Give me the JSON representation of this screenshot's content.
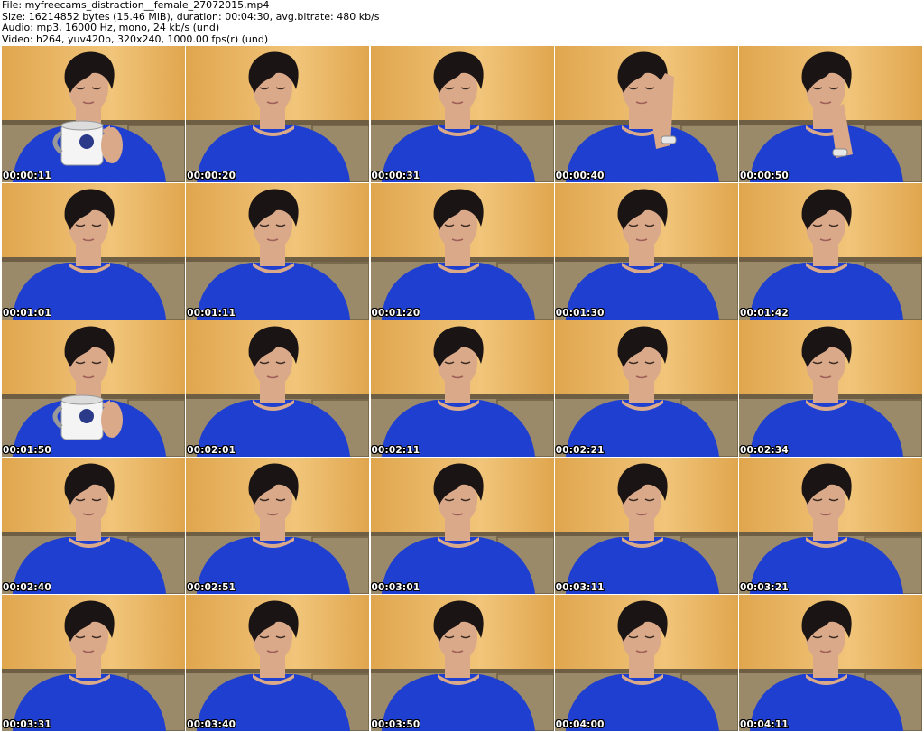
{
  "header": {
    "file_line": "File: myfreecams_distraction__female_27072015.mp4",
    "size_line": "Size: 16214852 bytes (15.46 MiB), duration: 00:04:30, avg.bitrate: 480 kb/s",
    "audio_line": "Audio: mp3, 16000 Hz, mono, 24 kb/s (und)",
    "video_line": "Video: h264, yuv420p, 320x240, 1000.00 fps(r) (und)"
  },
  "colors": {
    "wall": "#e0a64e",
    "wall_light": "#f1c57a",
    "sofa": "#9a8a6a",
    "sofa_dark": "#6e5f44",
    "sweater": "#1f3fd0",
    "skin": "#d9a98a",
    "hair": "#1a1414",
    "mug": "#f4f4f4"
  },
  "thumbnails": [
    {
      "time": "00:00:11",
      "pose": "mug"
    },
    {
      "time": "00:00:20",
      "pose": "down"
    },
    {
      "time": "00:00:31",
      "pose": "down"
    },
    {
      "time": "00:00:40",
      "pose": "hand"
    },
    {
      "time": "00:00:50",
      "pose": "chin"
    },
    {
      "time": "00:01:01",
      "pose": "down"
    },
    {
      "time": "00:01:11",
      "pose": "down"
    },
    {
      "time": "00:01:20",
      "pose": "down"
    },
    {
      "time": "00:01:30",
      "pose": "down"
    },
    {
      "time": "00:01:42",
      "pose": "down"
    },
    {
      "time": "00:01:50",
      "pose": "mug"
    },
    {
      "time": "00:02:01",
      "pose": "down"
    },
    {
      "time": "00:02:11",
      "pose": "down"
    },
    {
      "time": "00:02:21",
      "pose": "down"
    },
    {
      "time": "00:02:34",
      "pose": "down"
    },
    {
      "time": "00:02:40",
      "pose": "down"
    },
    {
      "time": "00:02:51",
      "pose": "down"
    },
    {
      "time": "00:03:01",
      "pose": "down"
    },
    {
      "time": "00:03:11",
      "pose": "down"
    },
    {
      "time": "00:03:21",
      "pose": "down"
    },
    {
      "time": "00:03:31",
      "pose": "down"
    },
    {
      "time": "00:03:40",
      "pose": "down"
    },
    {
      "time": "00:03:50",
      "pose": "down"
    },
    {
      "time": "00:04:00",
      "pose": "down"
    },
    {
      "time": "00:04:11",
      "pose": "down"
    }
  ]
}
